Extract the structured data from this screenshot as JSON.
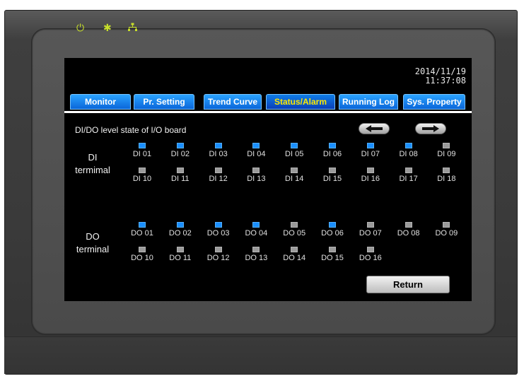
{
  "datetime": {
    "date": "2014/11/19",
    "time": "11:37:08"
  },
  "tabs": [
    {
      "label": "Monitor",
      "active": false
    },
    {
      "label": "Pr. Setting",
      "active": false
    },
    {
      "label": "Trend Curve",
      "active": false
    },
    {
      "label": "Status/Alarm",
      "active": true
    },
    {
      "label": "Running Log",
      "active": false
    },
    {
      "label": "Sys. Property",
      "active": false
    }
  ],
  "section_title": "DI/DO level state of I/O board",
  "nav": {
    "prev_icon": "arrow-left-icon",
    "next_icon": "arrow-right-icon"
  },
  "indicators": {
    "power_icon": "power-icon",
    "comm_icon": "comm-icon",
    "network_icon": "network-icon"
  },
  "di": {
    "label_line1": "DI",
    "label_line2": "termimal",
    "terminals": [
      {
        "label": "DI 01",
        "on": true
      },
      {
        "label": "DI 02",
        "on": true
      },
      {
        "label": "DI 03",
        "on": true
      },
      {
        "label": "DI 04",
        "on": true
      },
      {
        "label": "DI 05",
        "on": true
      },
      {
        "label": "DI 06",
        "on": true
      },
      {
        "label": "DI 07",
        "on": true
      },
      {
        "label": "DI 08",
        "on": true
      },
      {
        "label": "DI 09",
        "on": false
      },
      {
        "label": "DI 10",
        "on": false
      },
      {
        "label": "DI 11",
        "on": false
      },
      {
        "label": "DI 12",
        "on": false
      },
      {
        "label": "DI 13",
        "on": false
      },
      {
        "label": "DI 14",
        "on": false
      },
      {
        "label": "DI 15",
        "on": false
      },
      {
        "label": "DI 16",
        "on": false
      },
      {
        "label": "DI 17",
        "on": false
      },
      {
        "label": "DI 18",
        "on": false
      }
    ]
  },
  "do": {
    "label_line1": "DO",
    "label_line2": "terminal",
    "terminals": [
      {
        "label": "DO 01",
        "on": true
      },
      {
        "label": "DO 02",
        "on": true
      },
      {
        "label": "DO 03",
        "on": true
      },
      {
        "label": "DO 04",
        "on": true
      },
      {
        "label": "DO 05",
        "on": false
      },
      {
        "label": "DO 06",
        "on": true
      },
      {
        "label": "DO 07",
        "on": false
      },
      {
        "label": "DO 08",
        "on": false
      },
      {
        "label": "DO 09",
        "on": false
      },
      {
        "label": "DO 10",
        "on": false
      },
      {
        "label": "DO 11",
        "on": false
      },
      {
        "label": "DO 12",
        "on": false
      },
      {
        "label": "DO 13",
        "on": false
      },
      {
        "label": "DO 14",
        "on": false
      },
      {
        "label": "DO 15",
        "on": false
      },
      {
        "label": "DO 16",
        "on": false
      }
    ]
  },
  "return_label": "Return",
  "colors": {
    "led_on": "#1a8fff",
    "led_off": "#9a9a9a",
    "tab_blue": "#1583f0",
    "active_tab_text": "#ffe800"
  }
}
